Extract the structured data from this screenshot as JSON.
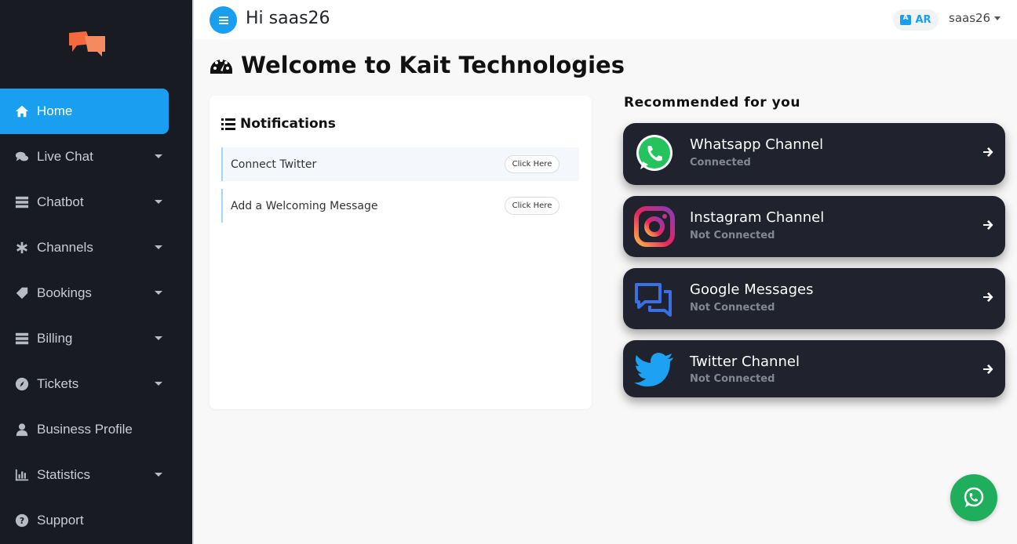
{
  "header": {
    "greeting": "Hi saas26",
    "lang_label": "AR",
    "user_label": "saas26"
  },
  "sidebar": {
    "logo_icon": "chat-bubbles-logo-icon",
    "items": [
      {
        "label": "Home",
        "icon": "home-icon",
        "active": true,
        "caret": false
      },
      {
        "label": "Live Chat",
        "icon": "comments-icon",
        "caret": true
      },
      {
        "label": "Chatbot",
        "icon": "server-icon",
        "caret": true
      },
      {
        "label": "Channels",
        "icon": "asterisk-icon",
        "caret": true
      },
      {
        "label": "Bookings",
        "icon": "ticket-tag-icon",
        "caret": true
      },
      {
        "label": "Billing",
        "icon": "stack-icon",
        "caret": true
      },
      {
        "label": "Tickets",
        "icon": "compass-icon",
        "caret": true
      },
      {
        "label": "Business Profile",
        "icon": "user-icon",
        "caret": false
      },
      {
        "label": "Statistics",
        "icon": "bar-chart-icon",
        "caret": true
      },
      {
        "label": "Support",
        "icon": "question-circle-icon",
        "caret": false
      }
    ]
  },
  "main": {
    "title": "Welcome to Kait Technologies",
    "notifications": {
      "title": "Notifications",
      "items": [
        {
          "text": "Connect Twitter",
          "button": "Click Here"
        },
        {
          "text": "Add a Welcoming Message",
          "button": "Click Here"
        }
      ]
    },
    "recommended": {
      "title": "Recommended for you",
      "channels": [
        {
          "name": "Whatsapp Channel",
          "status": "Connected",
          "icon": "whatsapp-icon"
        },
        {
          "name": "Instagram Channel",
          "status": "Not Connected",
          "icon": "instagram-icon"
        },
        {
          "name": "Google Messages",
          "status": "Not Connected",
          "icon": "google-messages-icon"
        },
        {
          "name": "Twitter Channel",
          "status": "Not Connected",
          "icon": "twitter-icon"
        }
      ]
    }
  },
  "colors": {
    "accent": "#1a9ff0",
    "sidebar_bg": "#181b22",
    "card_dark": "#20232d",
    "whatsapp_green": "#1fae5c"
  }
}
